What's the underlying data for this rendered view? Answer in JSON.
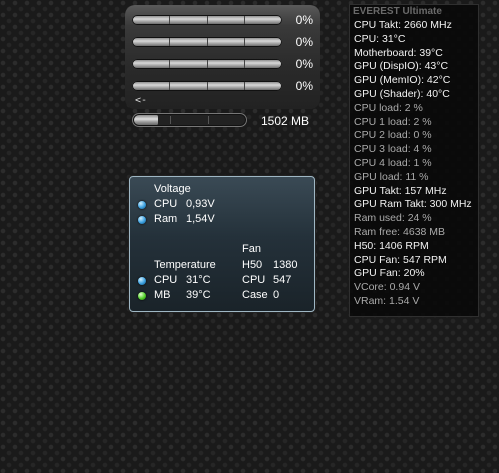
{
  "cpu_meter": {
    "cores": [
      {
        "percent_label": "0%",
        "load": 0
      },
      {
        "percent_label": "0%",
        "load": 0
      },
      {
        "percent_label": "0%",
        "load": 0
      },
      {
        "percent_label": "0%",
        "load": 0
      }
    ],
    "arrow_label": "<-",
    "memory_label": "1502 MB",
    "memory_fill_fraction": 0.22
  },
  "sensor_gadget": {
    "voltage_heading": "Voltage",
    "voltage": [
      {
        "name": "CPU",
        "value": "0,93V",
        "led": "blue"
      },
      {
        "name": "Ram",
        "value": "1,54V",
        "led": "blue"
      }
    ],
    "temperature_heading": "Temperature",
    "temperature": [
      {
        "name": "CPU",
        "value": "31°C",
        "led": "blue"
      },
      {
        "name": "MB",
        "value": "39°C",
        "led": "green"
      }
    ],
    "fan_heading": "Fan",
    "fan": [
      {
        "name": "H50",
        "value": "1380"
      },
      {
        "name": "CPU",
        "value": "547"
      },
      {
        "name": "Case",
        "value": "0"
      }
    ]
  },
  "everest": {
    "title": "EVEREST Ultimate",
    "rows": [
      {
        "text": "CPU Takt: 2660 MHz",
        "style": "white"
      },
      {
        "text": "CPU: 31°C",
        "style": "white"
      },
      {
        "text": "Motherboard: 39°C",
        "style": "white"
      },
      {
        "text": "GPU (DispIO): 43°C",
        "style": "white"
      },
      {
        "text": "GPU (MemIO): 42°C",
        "style": "white"
      },
      {
        "text": "GPU (Shader): 40°C",
        "style": "white"
      },
      {
        "text": "CPU load: 2 %",
        "style": "gray"
      },
      {
        "text": "CPU 1 load: 2 %",
        "style": "gray"
      },
      {
        "text": "CPU 2 load: 0 %",
        "style": "gray"
      },
      {
        "text": "CPU 3 load: 4 %",
        "style": "gray"
      },
      {
        "text": "CPU 4 load: 1 %",
        "style": "gray"
      },
      {
        "text": "GPU load: 11 %",
        "style": "gray"
      },
      {
        "text": "GPU Takt: 157 MHz",
        "style": "white"
      },
      {
        "text": "GPU Ram Takt: 300 MHz",
        "style": "white"
      },
      {
        "text": "Ram used: 24 %",
        "style": "gray"
      },
      {
        "text": "Ram free: 4638 MB",
        "style": "gray"
      },
      {
        "text": "H50: 1406 RPM",
        "style": "white"
      },
      {
        "text": "CPU Fan: 547 RPM",
        "style": "white"
      },
      {
        "text": "GPU Fan: 20%",
        "style": "white"
      },
      {
        "text": "VCore: 0.94 V",
        "style": "gray"
      },
      {
        "text": "VRam: 1.54 V",
        "style": "gray"
      }
    ]
  }
}
